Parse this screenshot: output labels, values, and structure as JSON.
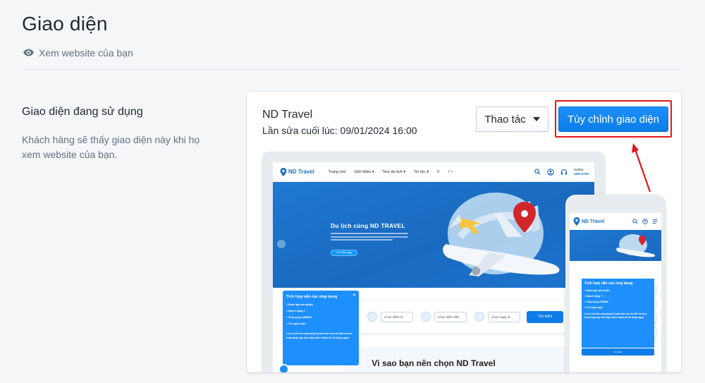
{
  "header": {
    "title": "Giao diện",
    "view_link": "Xem website của bạn"
  },
  "current_theme_section": {
    "title": "Giao diện đang sử dụng",
    "description": "Khách hàng sẽ thấy giao diện này khi họ xem website của bạn."
  },
  "theme_card": {
    "name": "ND Travel",
    "last_edited": "Lần sửa cuối lúc: 09/01/2024 16:00",
    "action_button": "Thao tác",
    "customize_button": "Tùy chỉnh giao diện"
  },
  "preview": {
    "logo": "ND Travel",
    "nav": [
      "Trang chủ",
      "Giới thiệu ▾",
      "Tour du lịch ▾",
      "Tin tức ▾",
      "F"
    ],
    "nav_arrows": "‹ ›",
    "hotline_label": "Hotline",
    "hotline_number": "1900 6750",
    "hero_title": "Du lịch cùng ND TRAVEL",
    "hero_button": "Tìm hiểu ngay",
    "search_from": "Chọn điểm đi",
    "search_to": "Chọn điểm đến",
    "search_date": "Chọn ngày đi",
    "search_button": "Tìm kiếm",
    "why_title": "Vì sao bạn nên chọn ND Travel",
    "popup": {
      "title": "Tích hợp sẵn các ứng dụng",
      "items": [
        "Đánh giá sản phẩm",
        "Mua X tặng Y",
        "Ứng dụng Affiliate",
        "Ưu ngôn ngữ"
      ],
      "note": "Lưu ý với các ứng dụng trả phí bạn cần cài đặt và mua ứng dụng này trên App store Sapo để sử dụng ngay",
      "close": "✕"
    }
  },
  "colors": {
    "primary": "#0d7ce6",
    "highlight_border": "#e0181b",
    "annotation_arrow": "#e0181b"
  },
  "icons": {
    "view": "eye-icon",
    "dropdown": "caret-down-icon"
  }
}
